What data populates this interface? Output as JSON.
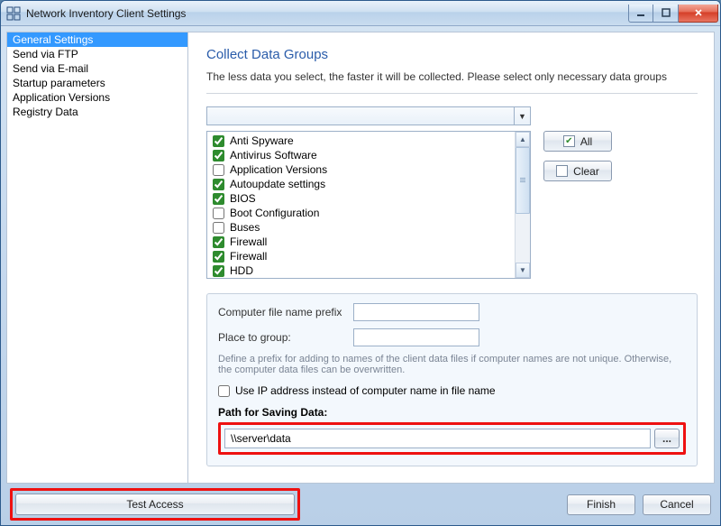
{
  "window": {
    "title": "Network Inventory Client Settings"
  },
  "sidebar": {
    "items": [
      {
        "label": "General Settings",
        "selected": true
      },
      {
        "label": "Send via FTP",
        "selected": false
      },
      {
        "label": "Send via E-mail",
        "selected": false
      },
      {
        "label": "Startup parameters",
        "selected": false
      },
      {
        "label": "Application Versions",
        "selected": false
      },
      {
        "label": "Registry Data",
        "selected": false
      }
    ]
  },
  "main": {
    "heading": "Collect Data Groups",
    "intro": "The less data you select, the faster it will be collected. Please select only necessary data groups",
    "all_label": "All",
    "clear_label": "Clear",
    "groups": [
      {
        "label": "Anti Spyware",
        "checked": true
      },
      {
        "label": "Antivirus Software",
        "checked": true
      },
      {
        "label": "Application Versions",
        "checked": false
      },
      {
        "label": "Autoupdate settings",
        "checked": true
      },
      {
        "label": "BIOS",
        "checked": true
      },
      {
        "label": "Boot Configuration",
        "checked": false
      },
      {
        "label": "Buses",
        "checked": false
      },
      {
        "label": "Firewall",
        "checked": true
      },
      {
        "label": "Firewall",
        "checked": true
      },
      {
        "label": "HDD",
        "checked": true
      }
    ],
    "panel": {
      "prefix_label": "Computer file name prefix",
      "prefix_value": "",
      "group_label": "Place to group:",
      "group_value": "",
      "hint": "Define a prefix for adding to names of the client data files if computer names are not unique. Otherwise, the computer data files can be overwritten.",
      "use_ip_label": "Use IP address instead of computer name in file name",
      "use_ip_checked": false,
      "path_label": "Path for Saving Data:",
      "path_value": "\\\\server\\data",
      "browse_label": "..."
    }
  },
  "footer": {
    "test_label": "Test Access",
    "finish_label": "Finish",
    "cancel_label": "Cancel"
  }
}
